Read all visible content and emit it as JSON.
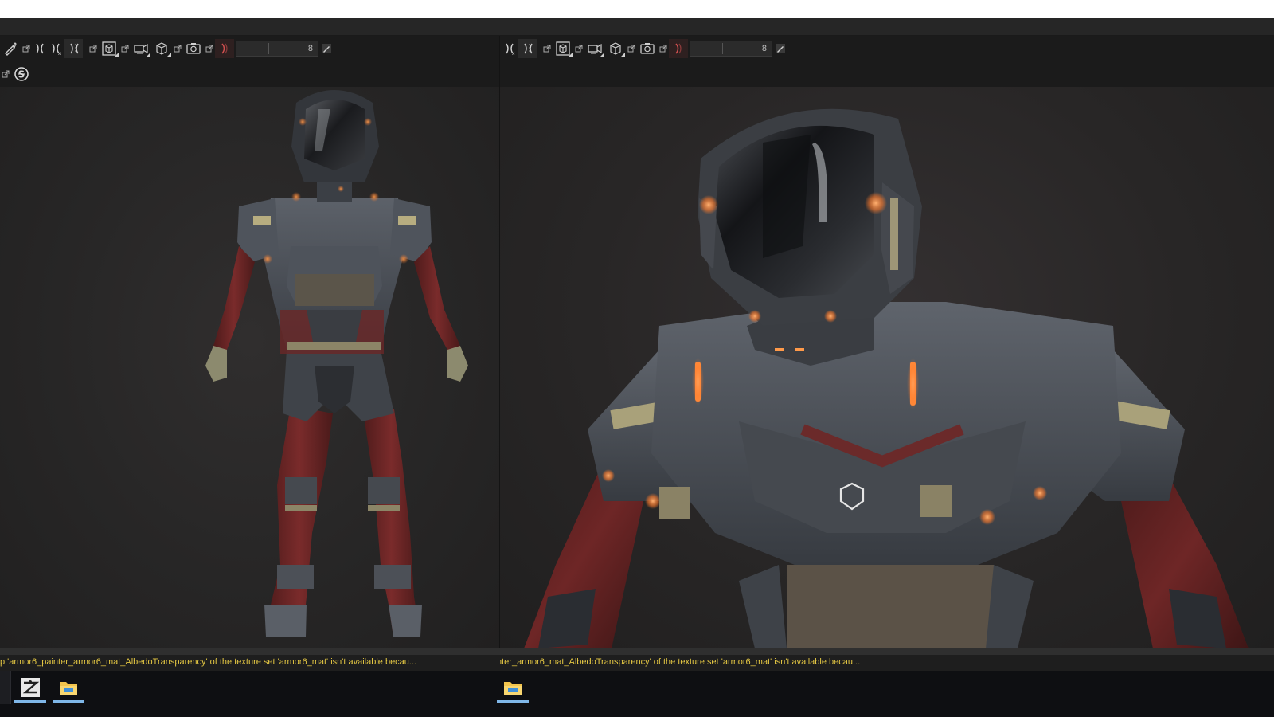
{
  "toolbar": {
    "left": {
      "slider_value": "8"
    },
    "right": {
      "slider_value": "8"
    }
  },
  "viewports": {
    "left": {
      "content": "full-body armor character model, front view"
    },
    "right": {
      "content": "armor character model close-up of helmet and chest"
    }
  },
  "status": {
    "left_message": "p 'armor6_painter_armor6_mat_AlbedoTransparency' of the texture set 'armor6_mat' isn't available becau...",
    "right_message": "nter_armor6_mat_AlbedoTransparency' of the texture set 'armor6_mat' isn't available becau..."
  },
  "taskbar": {
    "apps": [
      "zbrush-app-icon",
      "file-explorer-icon",
      "file-explorer-icon"
    ]
  },
  "colors": {
    "status_text": "#e4c743",
    "viewport_bg": "#272626",
    "armor_red": "#6b2424",
    "armor_steel": "#4a4f57",
    "glow": "#ff7a2a"
  }
}
